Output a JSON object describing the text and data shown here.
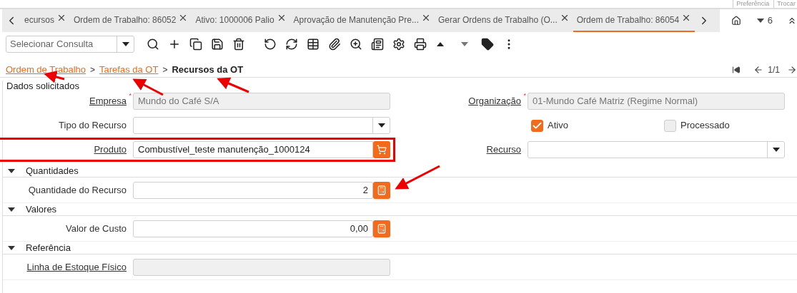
{
  "header_links": [
    "Preferência",
    "Trocar"
  ],
  "tabs": [
    {
      "label": "ecursos",
      "selected": false
    },
    {
      "label": "Ordem de Trabalho: 86052",
      "selected": false
    },
    {
      "label": "Ativo: 1000006 Palio",
      "selected": false
    },
    {
      "label": "Aprovação de Manutenção Pre...",
      "selected": false
    },
    {
      "label": "Gerar Ordens de Trabalho (O...",
      "selected": false
    },
    {
      "label": "Ordem de Trabalho: 86054",
      "selected": true
    }
  ],
  "window_count": "6",
  "query_select": {
    "placeholder": "Selecionar Consulta"
  },
  "breadcrumb": [
    {
      "label": "Ordem de Trabalho",
      "kind": "link"
    },
    {
      "label": "Tarefas da OT",
      "kind": "link"
    },
    {
      "label": "Recursos da OT",
      "kind": "current"
    }
  ],
  "breadcrumb_separators": [
    ">",
    ">"
  ],
  "pager": "1/1",
  "section_title": "Dados solicitados",
  "rows": [
    {
      "left": {
        "label": "Empresa",
        "kind": "readonly",
        "link": true,
        "required_mark": "*",
        "value": "Mundo do Café S/A"
      },
      "right": {
        "label": "Organização",
        "kind": "readonly",
        "link": true,
        "required_mark": "*",
        "value": "01-Mundo Café Matriz (Regime Normal)"
      }
    },
    {
      "left": {
        "label": "Tipo do Recurso",
        "kind": "select",
        "link": false
      },
      "right": {
        "kind": "checkboxes",
        "items": [
          {
            "label": "Ativo",
            "checked": true
          },
          {
            "label": "Processado",
            "checked": false
          }
        ]
      }
    },
    {
      "left": {
        "label": "Produto",
        "kind": "lookup",
        "link": true,
        "value": "Combustível_teste manutenção_1000124",
        "highlighted": true
      },
      "right": {
        "label": "Recurso",
        "kind": "select",
        "link": true
      }
    }
  ],
  "sections": [
    {
      "title": "Quantidades",
      "expanded": true,
      "fields": [
        {
          "label": "Quantidade do Recurso",
          "kind": "number",
          "link": false,
          "value": "2"
        }
      ]
    },
    {
      "title": "Valores",
      "expanded": true,
      "fields": [
        {
          "label": "Valor de Custo",
          "kind": "number",
          "link": false,
          "value": "0,00"
        }
      ]
    },
    {
      "title": "Referência",
      "expanded": true,
      "fields": [
        {
          "label": "Linha de Estoque Físico",
          "kind": "readonly",
          "link": true
        }
      ]
    }
  ]
}
